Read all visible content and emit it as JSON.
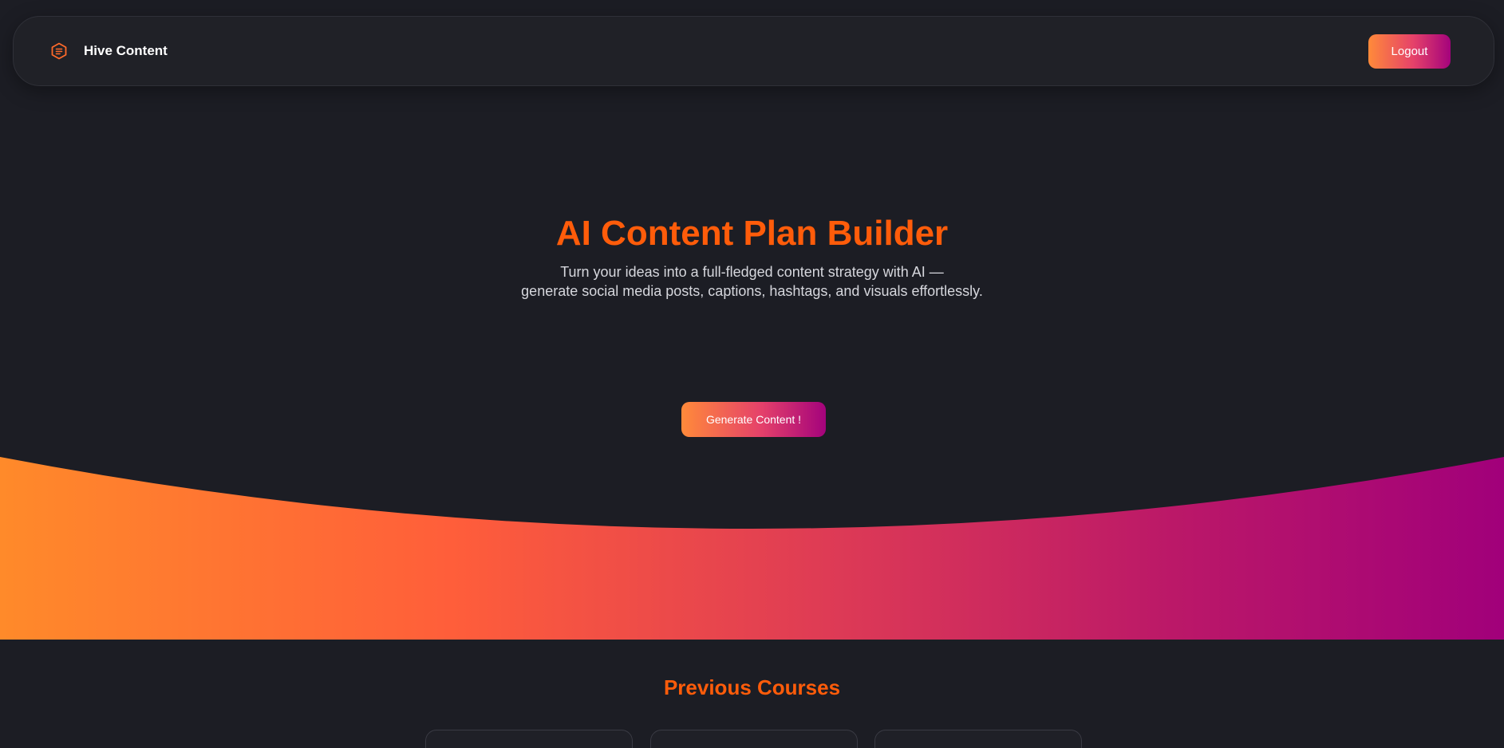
{
  "navbar": {
    "brand_icon": "document-hexagon-icon",
    "brand_name": "Hive Content",
    "logout_label": "Logout"
  },
  "hero": {
    "title": "AI Content Plan Builder",
    "subtitle_line1": "Turn your ideas into a full-fledged content strategy with AI —",
    "subtitle_line2": "generate social media posts, captions, hashtags, and visuals effortlessly.",
    "cta_label": "Generate Content !"
  },
  "courses": {
    "title": "Previous Courses",
    "cards": [
      {},
      {},
      {}
    ]
  },
  "colors": {
    "background": "#1c1d24",
    "accent_orange": "#ff5c0a",
    "gradient_start": "#ff8a3a",
    "gradient_mid": "#e5416a",
    "gradient_end": "#a4037c"
  }
}
